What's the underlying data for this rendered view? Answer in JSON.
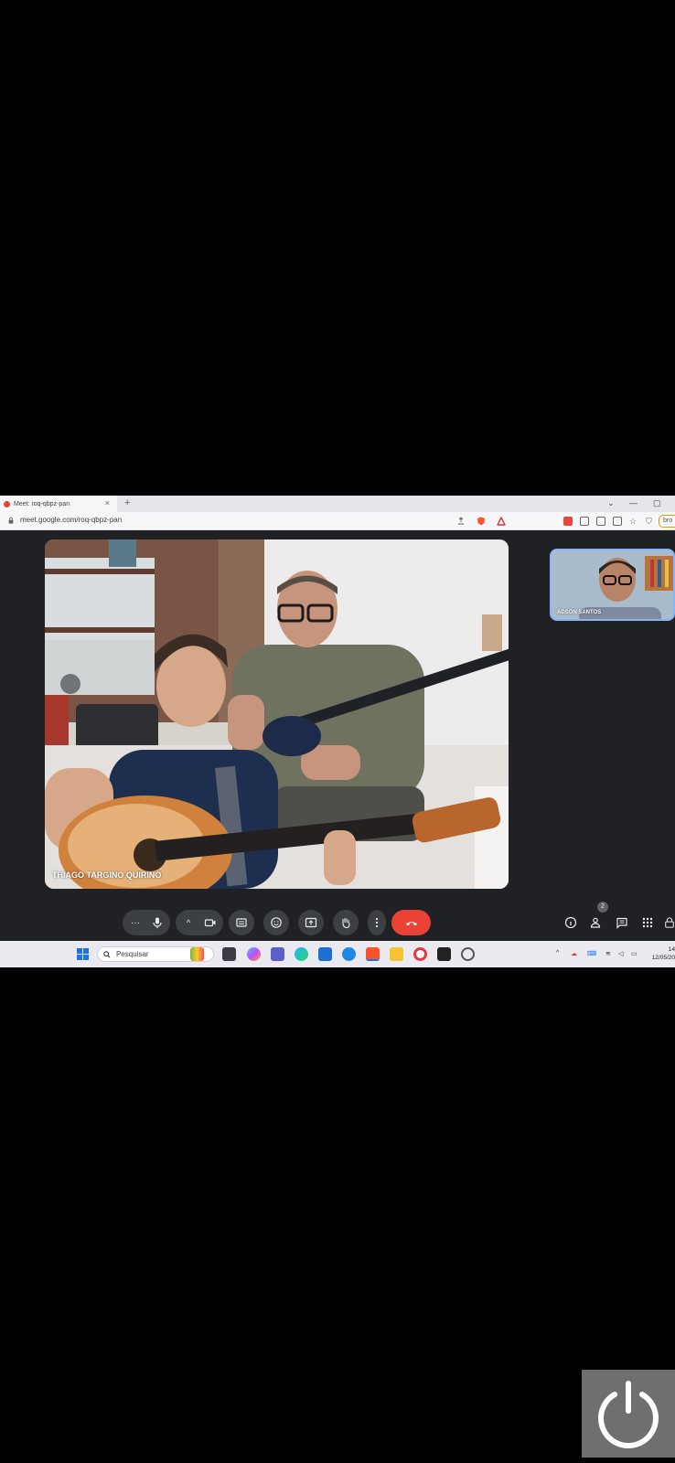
{
  "browser": {
    "tab_title": "Meet: roq-qbpz-pan",
    "new_tab_symbol": "+",
    "close_tab_symbol": "×",
    "url": "meet.google.com/roq-qbpz-pan",
    "window_buttons": [
      "⌄",
      "—",
      "▢"
    ],
    "extension_pill": "bro"
  },
  "meet": {
    "main_participant_name": "THIAGO TARGINO QUIRINO",
    "self_participant_name": "ADSON SANTOS",
    "people_count": "2",
    "more_options_symbol": "···",
    "chevron_symbol": "^"
  },
  "taskbar": {
    "search_placeholder": "Pesquisar",
    "tray_chevron": "^",
    "clock_time": "14",
    "clock_date": "12/05/20"
  },
  "colors": {
    "leave_button": "#ea4335",
    "meet_background": "#202124",
    "control_button": "#3c4043",
    "self_tile_border": "#8ab4f8",
    "taskbar": "#eaeaf0"
  },
  "icons": [
    "mic-icon",
    "camera-icon",
    "captions-icon",
    "emoji-icon",
    "present-icon",
    "raise-hand-icon",
    "more-vert-icon",
    "call-end-icon",
    "info-icon",
    "people-icon",
    "chat-icon",
    "apps-icon",
    "lock-icon",
    "windows-start-icon",
    "search-icon",
    "power-icon"
  ]
}
